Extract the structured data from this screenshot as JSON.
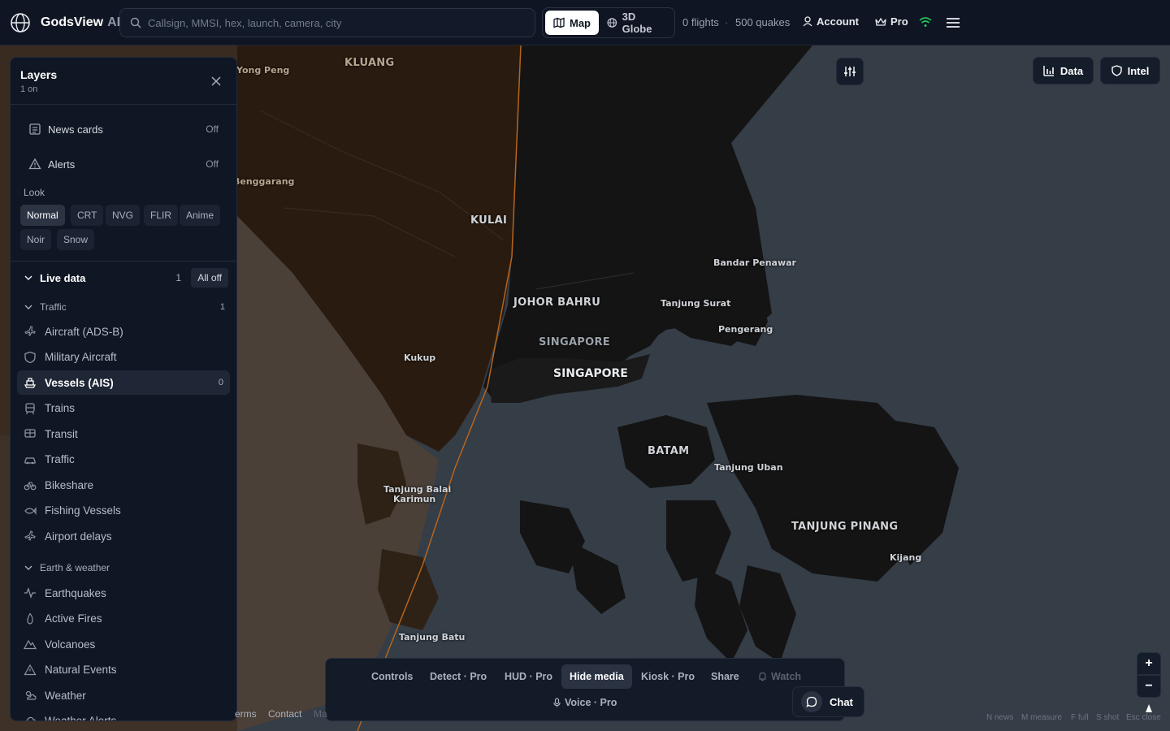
{
  "app": {
    "name": "GodsView",
    "suffix": "AI"
  },
  "search": {
    "placeholder": "Callsign, MMSI, hex, launch, camera, city",
    "value": ""
  },
  "modes": [
    {
      "label": "Map",
      "icon": "map-icon",
      "active": true
    },
    {
      "label": "3D Globe",
      "icon": "globe-icon",
      "active": false
    }
  ],
  "stats": {
    "flights": "0 flights",
    "separator": "·",
    "quakes": "500 quakes"
  },
  "nav": {
    "account": "Account",
    "pro": "Pro"
  },
  "layers_panel": {
    "title": "Layers",
    "subtitle": "1 on",
    "toggles": [
      {
        "label": "News cards",
        "value": "Off",
        "icon": "newspaper-icon"
      },
      {
        "label": "Alerts",
        "value": "Off",
        "icon": "alert-triangle-icon"
      }
    ],
    "look": {
      "label": "Look",
      "options": [
        "Normal",
        "CRT",
        "NVG",
        "FLIR",
        "Anime",
        "Noir",
        "Snow"
      ],
      "selected": "Normal"
    },
    "live_data": {
      "label": "Live data",
      "count": "1",
      "all_off": "All off"
    },
    "traffic": {
      "label": "Traffic",
      "count": "1",
      "items": [
        {
          "label": "Aircraft (ADS-B)",
          "icon": "plane-icon"
        },
        {
          "label": "Military Aircraft",
          "icon": "shield-icon"
        },
        {
          "label": "Vessels (AIS)",
          "icon": "ship-icon",
          "active": true,
          "count": "0"
        },
        {
          "label": "Trains",
          "icon": "train-icon"
        },
        {
          "label": "Transit",
          "icon": "bus-icon"
        },
        {
          "label": "Traffic",
          "icon": "car-icon"
        },
        {
          "label": "Bikeshare",
          "icon": "bike-icon"
        },
        {
          "label": "Fishing Vessels",
          "icon": "fish-icon"
        },
        {
          "label": "Airport delays",
          "icon": "plane-icon"
        }
      ]
    },
    "earth": {
      "label": "Earth & weather",
      "items": [
        {
          "label": "Earthquakes",
          "icon": "activity-icon"
        },
        {
          "label": "Active Fires",
          "icon": "flame-icon"
        },
        {
          "label": "Volcanoes",
          "icon": "mountain-icon"
        },
        {
          "label": "Natural Events",
          "icon": "alert-triangle-icon"
        },
        {
          "label": "Weather",
          "icon": "sun-cloud-icon"
        },
        {
          "label": "Weather Alerts",
          "icon": "cloud-alert-icon"
        }
      ]
    }
  },
  "map_buttons": {
    "data": "Data",
    "intel": "Intel"
  },
  "map_labels": [
    {
      "text": "KLUANG",
      "cls": "big muted"
    },
    {
      "text": "Yong Peng",
      "cls": "muted"
    },
    {
      "text": "Benggarang",
      "cls": "muted"
    },
    {
      "text": "KULAI",
      "cls": "big"
    },
    {
      "text": "Kukup",
      "cls": ""
    },
    {
      "text": "JOHOR BAHRU",
      "cls": "big"
    },
    {
      "text": "SINGAPORE",
      "cls": "big soft"
    },
    {
      "text": "SINGAPORE",
      "cls": "xl"
    },
    {
      "text": "Bandar Penawar",
      "cls": ""
    },
    {
      "text": "Tanjung Surat",
      "cls": ""
    },
    {
      "text": "Pengerang",
      "cls": ""
    },
    {
      "text": "BATAM",
      "cls": "big"
    },
    {
      "text": "Tanjung Uban",
      "cls": ""
    },
    {
      "text": "TANJUNG PINANG",
      "cls": "big"
    },
    {
      "text": "Kijang",
      "cls": ""
    },
    {
      "text": "Tanjung Balai",
      "cls": ""
    },
    {
      "text": "Karimun",
      "cls": ""
    },
    {
      "text": "Tanjung Batu",
      "cls": ""
    }
  ],
  "bottom_bar": {
    "buttons": [
      {
        "label": "Controls"
      },
      {
        "label": "Detect · Pro"
      },
      {
        "label": "HUD · Pro"
      },
      {
        "label": "Hide media",
        "active": true
      },
      {
        "label": "Kiosk · Pro"
      },
      {
        "label": "Share"
      },
      {
        "label": "Watch",
        "dim": true
      }
    ],
    "voice": "Voice · Pro"
  },
  "chat": {
    "label": "Chat"
  },
  "zoom": {
    "in": "+",
    "out": "−"
  },
  "footer": {
    "terms": "erms",
    "contact": "Contact",
    "map_by": "Ma"
  },
  "hints": [
    "N news",
    "M measure",
    "F full",
    "S shot",
    "Esc close"
  ],
  "colors": {
    "topbar": "#0f1522",
    "panel": "#101724",
    "sea": "#353d47",
    "land_dark": "#141414",
    "land_brown": "#2a1b10",
    "accent_wifi": "#22c55e"
  }
}
